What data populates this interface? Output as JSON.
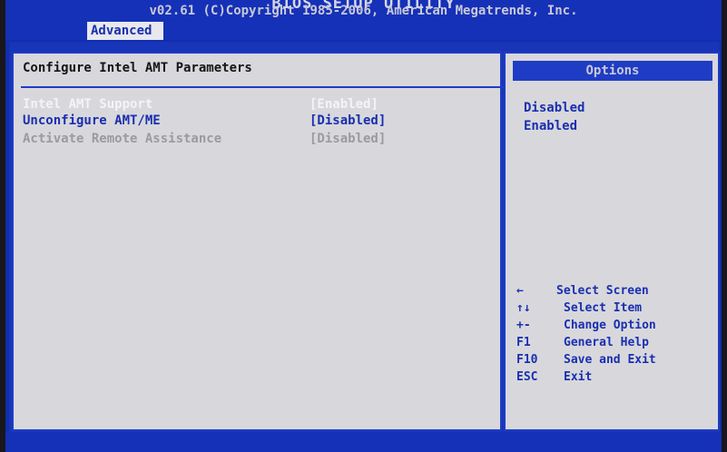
{
  "header": {
    "title": "BIOS SETUP UTILITY",
    "active_tab": "Advanced"
  },
  "main": {
    "heading": "Configure Intel AMT Parameters",
    "settings": [
      {
        "label": "Intel AMT Support",
        "value": "[Enabled]"
      },
      {
        "label": "Unconfigure AMT/ME",
        "value": "[Disabled]"
      },
      {
        "label": "Activate Remote Assistance",
        "value": "[Disabled]"
      }
    ]
  },
  "options": {
    "header": "Options",
    "items": [
      "Disabled",
      "Enabled"
    ]
  },
  "help": [
    {
      "key": "←",
      "text": "Select Screen"
    },
    {
      "key": "↑↓",
      "text": "Select Item"
    },
    {
      "key": "+-",
      "text": "Change Option"
    },
    {
      "key": "F1",
      "text": "General Help"
    },
    {
      "key": "F10",
      "text": "Save and Exit"
    },
    {
      "key": "ESC",
      "text": "Exit"
    }
  ],
  "footer": {
    "text": "v02.61 (C)Copyright 1985-2006, American Megatrends, Inc."
  },
  "colors": {
    "bios_blue": "#1531b8",
    "panel_gray": "#d8d8dc",
    "highlight_white": "#f4f4f6",
    "text_blue": "#1a2fb0"
  }
}
